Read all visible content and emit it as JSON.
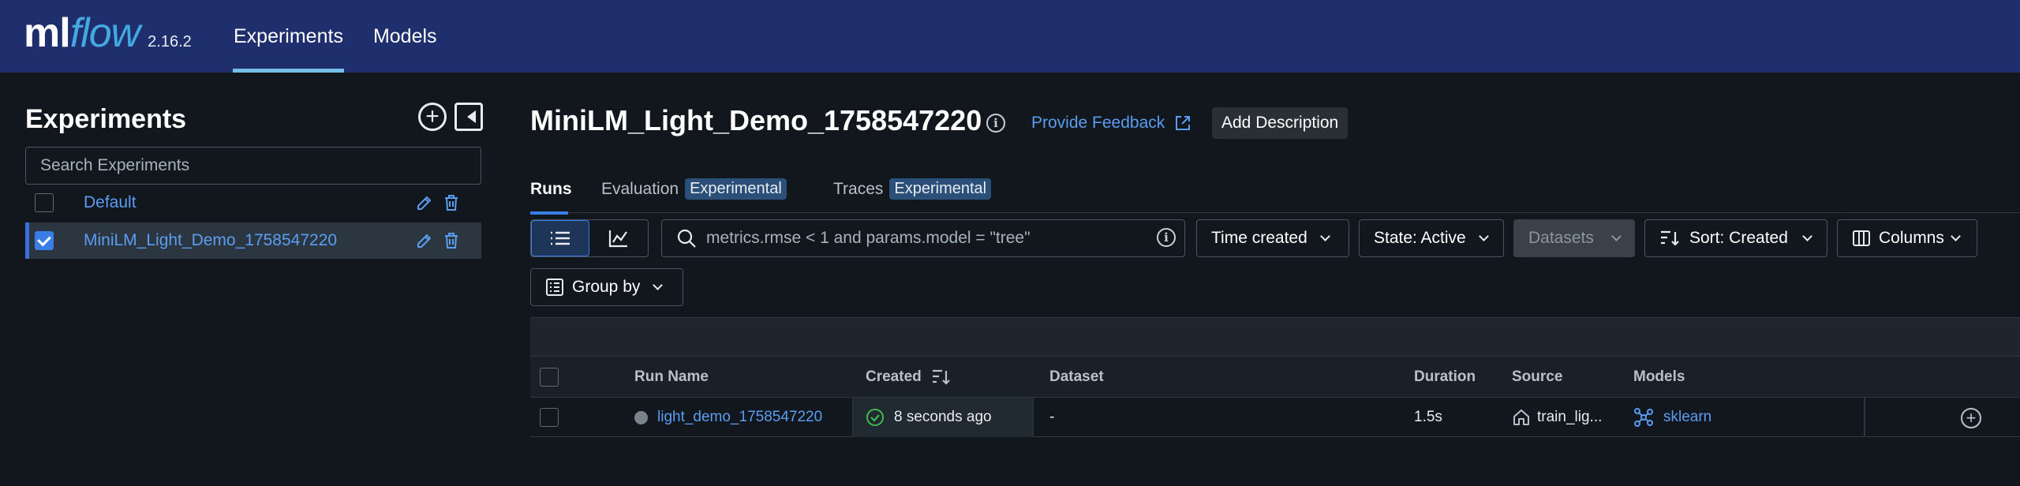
{
  "app": {
    "logo_ml": "ml",
    "logo_flow": "flow",
    "version": "2.16.2",
    "nav": [
      "Experiments",
      "Models"
    ],
    "accent": "#3b7de8",
    "topbar_color": "#1f2f6e"
  },
  "sidebar": {
    "title": "Experiments",
    "search_placeholder": "Search Experiments",
    "experiments": [
      {
        "name": "Default",
        "checked": false
      },
      {
        "name": "MiniLM_Light_Demo_1758547220",
        "checked": true
      }
    ],
    "icons": [
      "plus-circle-icon",
      "collapse-sidebar-icon",
      "pencil-icon",
      "trash-icon"
    ]
  },
  "main": {
    "title": "MiniLM_Light_Demo_1758547220",
    "feedback_label": "Provide Feedback",
    "add_description_label": "Add Description",
    "tabs": [
      {
        "label": "Runs",
        "badge": ""
      },
      {
        "label": "Evaluation",
        "badge": "Experimental"
      },
      {
        "label": "Traces",
        "badge": "Experimental"
      }
    ],
    "search_placeholder": "metrics.rmse < 1 and params.model = \"tree\"",
    "filters": {
      "time": "Time created",
      "state": "State: Active",
      "datasets": "Datasets",
      "sort": "Sort: Created",
      "columns": "Columns",
      "group_by": "Group by"
    },
    "table": {
      "columns": [
        "Run Name",
        "Created",
        "Dataset",
        "Duration",
        "Source",
        "Models"
      ],
      "rows": [
        {
          "run_name": "light_demo_1758547220",
          "created": "8 seconds ago",
          "dataset": "-",
          "duration": "1.5s",
          "source": "train_lig...",
          "models": "sklearn"
        }
      ]
    }
  }
}
